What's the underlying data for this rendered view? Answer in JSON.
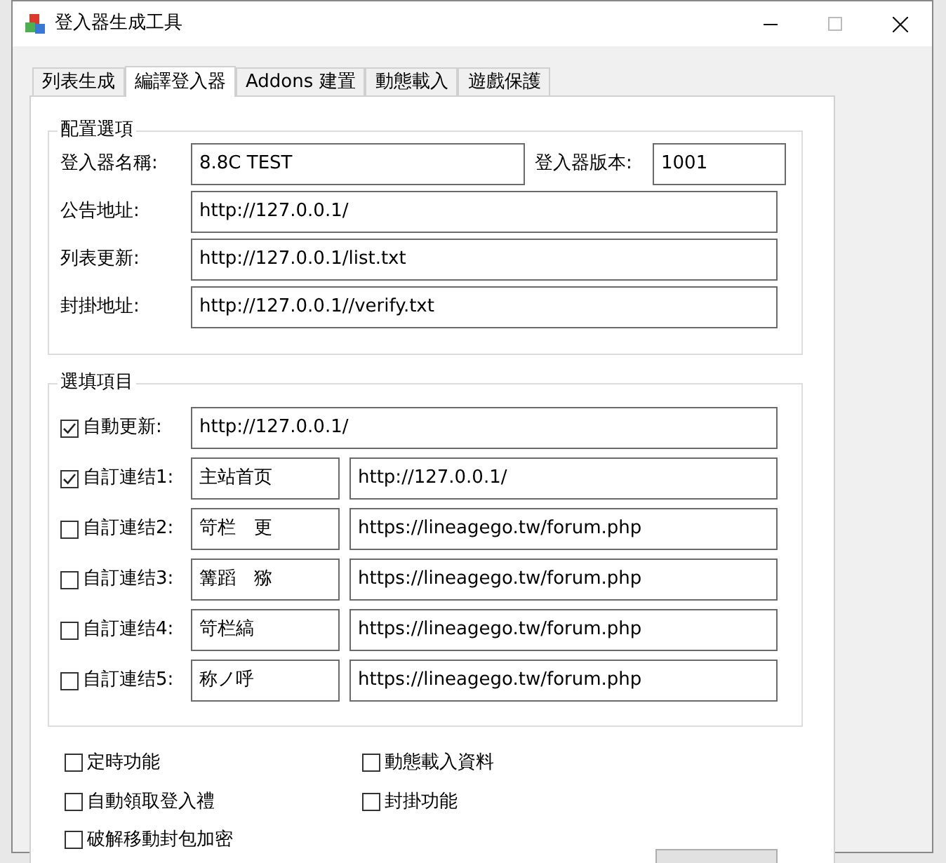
{
  "window": {
    "title": "登入器生成工具"
  },
  "tabs": [
    {
      "label": "列表生成",
      "selected": false
    },
    {
      "label": "編譯登入器",
      "selected": true
    },
    {
      "label": "Addons 建置",
      "selected": false
    },
    {
      "label": "動態載入",
      "selected": false
    },
    {
      "label": "遊戲保護",
      "selected": false
    }
  ],
  "config_group": {
    "title": "配置選項",
    "name_label": "登入器名稱:",
    "name_value": "8.8C TEST",
    "version_label": "登入器版本:",
    "version_value": "1001",
    "fields": [
      {
        "label": "公告地址:",
        "value": "http://127.0.0.1/"
      },
      {
        "label": "列表更新:",
        "value": "http://127.0.0.1/list.txt"
      },
      {
        "label": "封掛地址:",
        "value": "http://127.0.0.1//verify.txt"
      }
    ]
  },
  "optional_group": {
    "title": "選填項目",
    "auto_update": {
      "label": "自動更新:",
      "checked": true,
      "value": "http://127.0.0.1/"
    },
    "links": [
      {
        "label": "自訂連结1:",
        "checked": true,
        "name": "主站首页",
        "url": "http://127.0.0.1/"
      },
      {
        "label": "自訂連结2:",
        "checked": false,
        "name": "笴栏　更",
        "url": "https://lineagego.tw/forum.php"
      },
      {
        "label": "自訂連结3:",
        "checked": false,
        "name": "篝蹈　猕",
        "url": "https://lineagego.tw/forum.php"
      },
      {
        "label": "自訂連结4:",
        "checked": false,
        "name": "笴栏縞",
        "url": "https://lineagego.tw/forum.php"
      },
      {
        "label": "自訂連结5:",
        "checked": false,
        "name": "称ノ呼",
        "url": "https://lineagego.tw/forum.php"
      }
    ]
  },
  "options": [
    {
      "label": "定時功能",
      "checked": false
    },
    {
      "label": "動態載入資料",
      "checked": false
    },
    {
      "label": "自動領取登入禮",
      "checked": false
    },
    {
      "label": "封掛功能",
      "checked": false
    },
    {
      "label": "破解移動封包加密",
      "checked": false
    }
  ]
}
